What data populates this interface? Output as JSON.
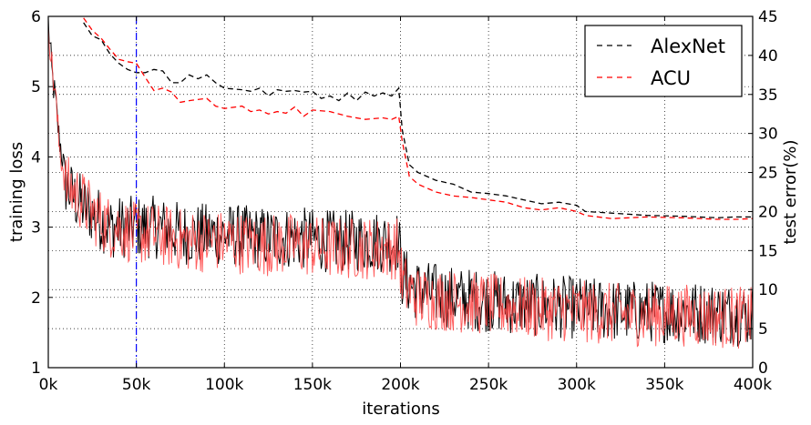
{
  "chart_data": {
    "type": "line",
    "xlabel": "iterations",
    "ylabel_left": "training loss",
    "ylabel_right": "test error(%)",
    "xlim": [
      0,
      400000
    ],
    "ylim_left": [
      1,
      6
    ],
    "ylim_right": [
      0,
      45
    ],
    "x_ticks": [
      0,
      50000,
      100000,
      150000,
      200000,
      250000,
      300000,
      350000,
      400000
    ],
    "x_tick_labels": [
      "0k",
      "50k",
      "100k",
      "150k",
      "200k",
      "250k",
      "300k",
      "350k",
      "400k"
    ],
    "y_left_ticks": [
      1,
      2,
      3,
      4,
      5,
      6
    ],
    "y_left_tick_labels": [
      "1",
      "2",
      "3",
      "4",
      "5",
      "6"
    ],
    "y_right_ticks": [
      0,
      5,
      10,
      15,
      20,
      25,
      30,
      35,
      40,
      45
    ],
    "y_right_tick_labels": [
      "0",
      "5",
      "10",
      "15",
      "20",
      "25",
      "30",
      "35",
      "40",
      "45"
    ],
    "grid": true,
    "legend_position": "top-right",
    "legend": [
      "AlexNet",
      "ACU"
    ],
    "vline": {
      "x": 50000,
      "color": "#0000ff",
      "style": "dash-dot"
    },
    "series": [
      {
        "name": "AlexNet",
        "axis": "right",
        "style": "dashed",
        "color": "#000000",
        "x": [
          20000,
          25000,
          30000,
          35000,
          40000,
          45000,
          50000,
          55000,
          60000,
          65000,
          70000,
          75000,
          80000,
          85000,
          90000,
          95000,
          100000,
          110000,
          115000,
          120000,
          125000,
          130000,
          135000,
          140000,
          145000,
          150000,
          155000,
          160000,
          165000,
          170000,
          175000,
          180000,
          185000,
          190000,
          195000,
          199000,
          201000,
          205000,
          210000,
          220000,
          230000,
          240000,
          250000,
          260000,
          270000,
          280000,
          290000,
          295000,
          300000,
          305000,
          320000,
          340000,
          360000,
          380000,
          390000,
          400000
        ],
        "y": [
          44.2,
          42.5,
          42,
          40.2,
          39,
          38.2,
          37.8,
          37.8,
          38.2,
          38,
          36.5,
          36.5,
          37.5,
          37,
          37.5,
          36.5,
          35.8,
          35.6,
          35.4,
          35.8,
          34.8,
          35.6,
          35.4,
          35.5,
          35.3,
          35.4,
          34.5,
          34.8,
          34.2,
          35.2,
          34.2,
          35.3,
          34.8,
          35.2,
          34.8,
          35.8,
          30.5,
          26,
          25,
          24,
          23.5,
          22.5,
          22.3,
          22,
          21.5,
          21,
          21.2,
          21,
          20.8,
          20,
          19.8,
          19.5,
          19.4,
          19.2,
          19.3,
          19.3
        ]
      },
      {
        "name": "ACU",
        "axis": "right",
        "style": "dashed",
        "color": "#ff0000",
        "x": [
          20000,
          25000,
          30000,
          35000,
          40000,
          45000,
          50000,
          55000,
          60000,
          65000,
          70000,
          75000,
          80000,
          90000,
          95000,
          100000,
          110000,
          115000,
          120000,
          125000,
          130000,
          135000,
          140000,
          145000,
          150000,
          160000,
          170000,
          180000,
          190000,
          195000,
          199000,
          201000,
          205000,
          210000,
          220000,
          230000,
          240000,
          250000,
          260000,
          270000,
          280000,
          290000,
          300000,
          305000,
          320000,
          340000,
          360000,
          380000,
          390000,
          400000
        ],
        "y": [
          44.8,
          43.2,
          42.2,
          40.8,
          39.5,
          39.2,
          39,
          37.2,
          35.5,
          35.8,
          35.3,
          34,
          34.2,
          34.5,
          33.5,
          33.2,
          33.5,
          32.8,
          33,
          32.5,
          32.8,
          32.6,
          33.4,
          32.2,
          33,
          32.8,
          32.2,
          31.8,
          32,
          31.8,
          32.2,
          29,
          24.5,
          23.5,
          22.5,
          22,
          21.8,
          21.5,
          21.2,
          20.5,
          20.2,
          20.5,
          20,
          19.5,
          19.1,
          19.3,
          19.2,
          19,
          19,
          19.1
        ]
      },
      {
        "name": "AlexNet",
        "axis": "left",
        "style": "solid",
        "color": "#000000",
        "note": "noisy training loss; sampled envelope",
        "x": [
          0,
          2000,
          4000,
          6000,
          8000,
          10000,
          15000,
          20000,
          25000,
          30000,
          35000,
          40000,
          45000,
          50000,
          60000,
          70000,
          80000,
          90000,
          100000,
          120000,
          140000,
          160000,
          180000,
          195000,
          199000,
          201000,
          205000,
          210000,
          230000,
          250000,
          270000,
          300000,
          330000,
          360000,
          400000
        ],
        "y": [
          5.9,
          5.2,
          4.8,
          4.3,
          4.0,
          3.6,
          3.4,
          3.3,
          3.2,
          3.1,
          3.0,
          3.0,
          3.0,
          3.0,
          3.0,
          2.95,
          2.9,
          2.9,
          2.9,
          2.85,
          2.85,
          2.8,
          2.8,
          2.8,
          2.8,
          2.3,
          2.2,
          2.1,
          2.0,
          1.95,
          1.9,
          1.85,
          1.8,
          1.8,
          1.75
        ]
      },
      {
        "name": "ACU",
        "axis": "left",
        "style": "solid",
        "color": "#ff4444",
        "note": "noisy training loss; sampled envelope",
        "x": [
          0,
          2000,
          4000,
          6000,
          8000,
          10000,
          15000,
          20000,
          25000,
          30000,
          35000,
          40000,
          45000,
          50000,
          60000,
          70000,
          80000,
          90000,
          100000,
          120000,
          140000,
          160000,
          180000,
          195000,
          199000,
          201000,
          205000,
          210000,
          230000,
          250000,
          270000,
          300000,
          330000,
          360000,
          400000
        ],
        "y": [
          5.95,
          5.3,
          4.9,
          4.2,
          3.9,
          3.6,
          3.5,
          3.35,
          3.2,
          3.1,
          3.0,
          3.0,
          2.95,
          2.9,
          2.9,
          2.85,
          2.8,
          2.8,
          2.8,
          2.75,
          2.75,
          2.7,
          2.7,
          2.7,
          2.7,
          2.2,
          2.1,
          2.0,
          1.95,
          1.9,
          1.85,
          1.8,
          1.75,
          1.75,
          1.7
        ]
      }
    ]
  }
}
